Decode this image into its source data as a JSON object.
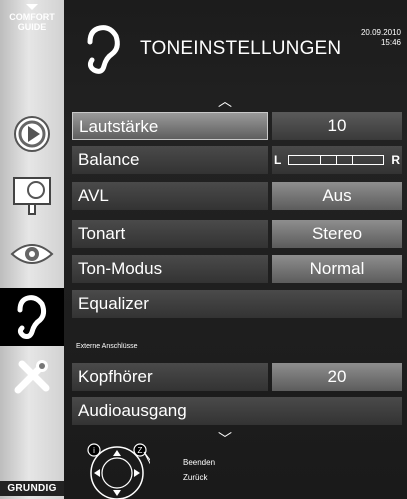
{
  "sidebar": {
    "comfort_guide": "COMFORT\nGUIDE",
    "comfort_line1": "COMFORT",
    "comfort_line2": "GUIDE",
    "items": [
      {
        "icon": "play-source-icon"
      },
      {
        "icon": "picture-settings-icon"
      },
      {
        "icon": "eye-icon"
      },
      {
        "icon": "ear-icon",
        "active": true
      },
      {
        "icon": "tools-icon"
      }
    ],
    "brand": "GRUNDIG"
  },
  "header": {
    "title": "TONEINSTELLUNGEN",
    "date": "20.09.2010",
    "time": "15:46",
    "icon": "ear-icon"
  },
  "menu": {
    "rows": [
      {
        "label": "Lautstärke",
        "value": "10"
      },
      {
        "label": "Balance",
        "value_left": "L",
        "value_right": "R"
      },
      {
        "label": "AVL",
        "value": "Aus"
      },
      {
        "label": "Tonart",
        "value": "Stereo"
      },
      {
        "label": "Ton-Modus",
        "value": "Normal"
      },
      {
        "label": "Equalizer"
      }
    ],
    "section_title": "Externe Anschlüsse",
    "rows2": [
      {
        "label": "Kopfhörer",
        "value": "20"
      },
      {
        "label": "Audioausgang"
      }
    ]
  },
  "footer": {
    "hint_back_label": "Beenden",
    "hint_zurueck_label": "Zurück"
  },
  "colors": {
    "background": "#1c1c1c",
    "row": "#3e3e3e",
    "row_selected": "#7a7a7a",
    "text": "#ffffff"
  }
}
